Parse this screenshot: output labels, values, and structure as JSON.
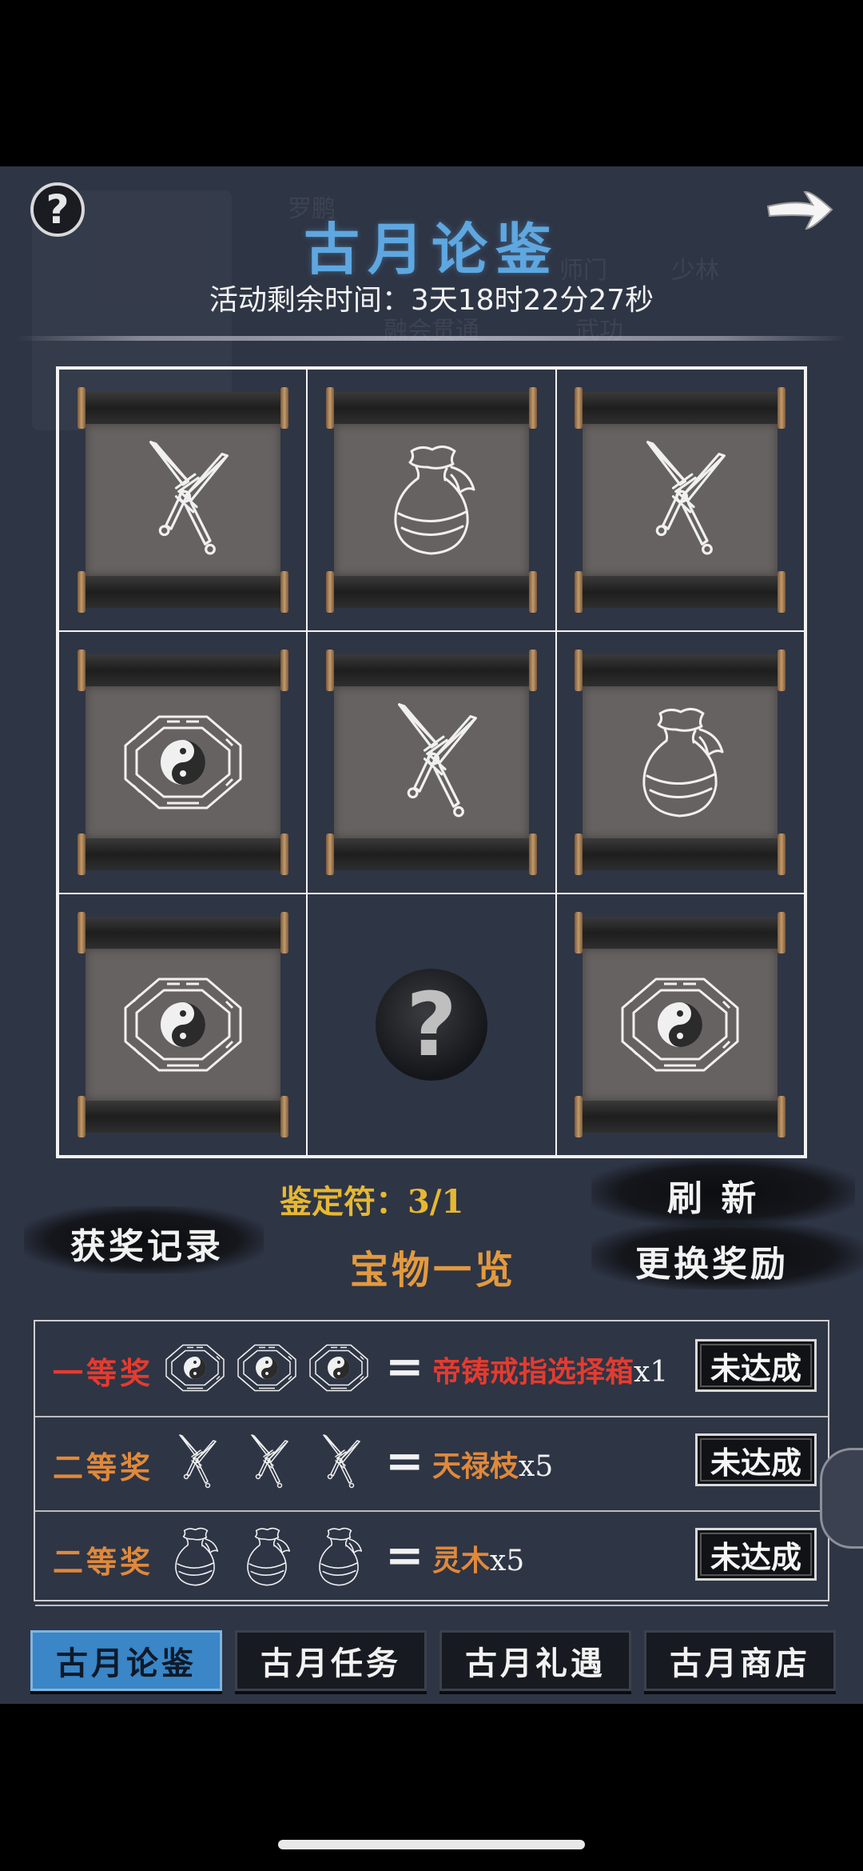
{
  "header": {
    "title": "古月论鉴",
    "timer": "活动剩余时间：3天18时22分27秒",
    "help_icon": "question-mark-icon",
    "back_icon": "arrow-right-icon"
  },
  "background_text": [
    "罗鹏",
    "师门",
    "少林",
    "武功",
    "融会贯通"
  ],
  "grid": {
    "cells": [
      {
        "icon": "crossed-swords-icon"
      },
      {
        "icon": "pouch-icon"
      },
      {
        "icon": "crossed-swords-icon"
      },
      {
        "icon": "bagua-icon"
      },
      {
        "icon": "crossed-swords-icon"
      },
      {
        "icon": "pouch-icon"
      },
      {
        "icon": "bagua-icon"
      },
      {
        "icon": "question-mark-icon",
        "hidden": true
      },
      {
        "icon": "bagua-icon"
      }
    ]
  },
  "controls": {
    "ticket": "鉴定符：3/1",
    "records_label": "获奖记录",
    "refresh_label": "刷 新",
    "treasure_label": "宝物一览",
    "change_reward_label": "更换奖励"
  },
  "rewards": [
    {
      "tier": "一等奖",
      "icon": "bagua-icon",
      "prize": "帝铸戒指选择箱",
      "qty": "x1",
      "status": "未达成"
    },
    {
      "tier": "二等奖",
      "icon": "crossed-swords-icon",
      "prize": "天禄枝",
      "qty": "x5",
      "status": "未达成"
    },
    {
      "tier": "二等奖",
      "icon": "pouch-icon",
      "prize": "灵木",
      "qty": "x5",
      "status": "未达成"
    }
  ],
  "tabs": [
    {
      "label": "古月论鉴",
      "active": true
    },
    {
      "label": "古月任务",
      "active": false
    },
    {
      "label": "古月礼遇",
      "active": false
    },
    {
      "label": "古月商店",
      "active": false
    }
  ],
  "colors": {
    "background": "#2e3545",
    "title": "#5ea7e0",
    "ticket": "#e6b832",
    "first_prize": "#e53b2f",
    "second_prize": "#e0893a",
    "active_tab": "#3a86c6"
  }
}
